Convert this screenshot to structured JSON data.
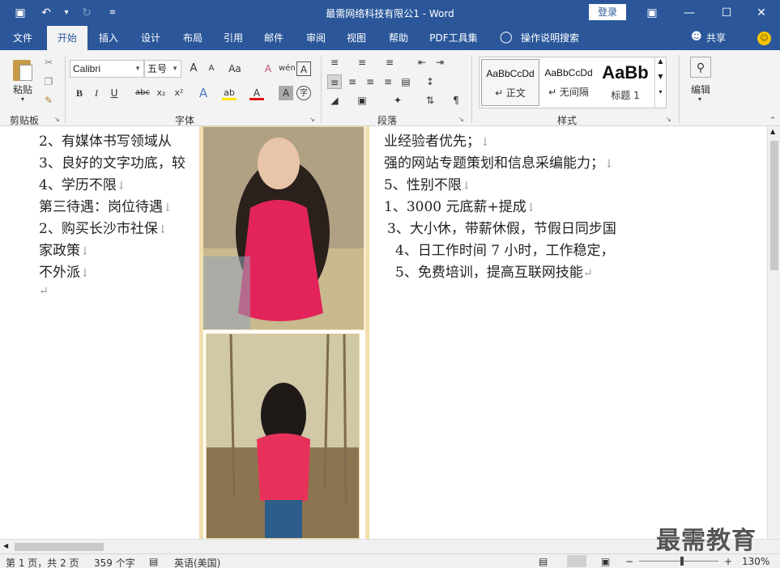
{
  "titlebar": {
    "title": "最需网络科技有限公1  -  Word",
    "login": "登录",
    "qat": {
      "save_icon": "▣",
      "undo_icon": "↶",
      "undo_drop": "▾",
      "redo_icon": "↻",
      "customize_icon": "≡"
    },
    "window": {
      "ribbon_options": "▣",
      "minimize": "—",
      "maximize": "☐",
      "close": "✕"
    }
  },
  "tabs": [
    "文件",
    "开始",
    "插入",
    "设计",
    "布局",
    "引用",
    "邮件",
    "审阅",
    "视图",
    "帮助",
    "PDF工具集"
  ],
  "tell_me": "操作说明搜索",
  "share": "共享",
  "ribbon": {
    "clipboard": {
      "label": "剪贴板",
      "paste": "粘贴"
    },
    "font": {
      "label": "字体",
      "name": "Calibri",
      "size": "五号",
      "bold": "B",
      "italic": "I",
      "underline": "U",
      "strike": "abc",
      "sub": "x₂",
      "sup": "x²",
      "grow": "A",
      "shrink": "A",
      "case": "Aa",
      "clear": "A",
      "phonetic": "wén",
      "border": "A",
      "effects": "A",
      "highlight": "ab",
      "color": "A",
      "shade": "A",
      "enclose": "字"
    },
    "paragraph": {
      "label": "段落"
    },
    "styles": {
      "label": "样式",
      "items": [
        {
          "sample": "AaBbCcDd",
          "name": "↵ 正文"
        },
        {
          "sample": "AaBbCcDd",
          "name": "↵ 无间隔"
        },
        {
          "sample": "AaBb",
          "name": "标题 1"
        }
      ]
    },
    "editing": {
      "label": "编辑"
    }
  },
  "document": {
    "left_lines": [
      "2、有媒体书写领域从",
      "3、良好的文字功底，较",
      "4、学历不限",
      "第三待遇：岗位待遇",
      "2、购买长沙市社保",
      "家政策",
      "不外派",
      ""
    ],
    "left_marks": [
      "",
      "",
      "↓",
      "↓",
      "↓",
      "↓",
      "↓",
      "↵"
    ],
    "right_lines": [
      "业经验者优先；",
      "强的网站专题策划和信息采编能力；",
      "5、性别不限",
      "1、3000 元底薪+提成",
      "3、大小休，带薪休假，节假日同步国",
      "4、日工作时间  7  小时，工作稳定，",
      "5、免费培训，提高互联网技能"
    ],
    "right_marks": [
      "↓",
      "↓",
      "↓",
      "↓",
      "",
      "",
      "↵"
    ]
  },
  "watermark": "最需教育",
  "statusbar": {
    "page": "第 1 页，共 2 页",
    "words": "359 个字",
    "language": "英语(美国)",
    "zoom_minus": "−",
    "zoom_plus": "+",
    "zoom": "130%"
  },
  "colors": {
    "brand": "#2b579a",
    "ribbon_bg": "#f3f3f3"
  }
}
